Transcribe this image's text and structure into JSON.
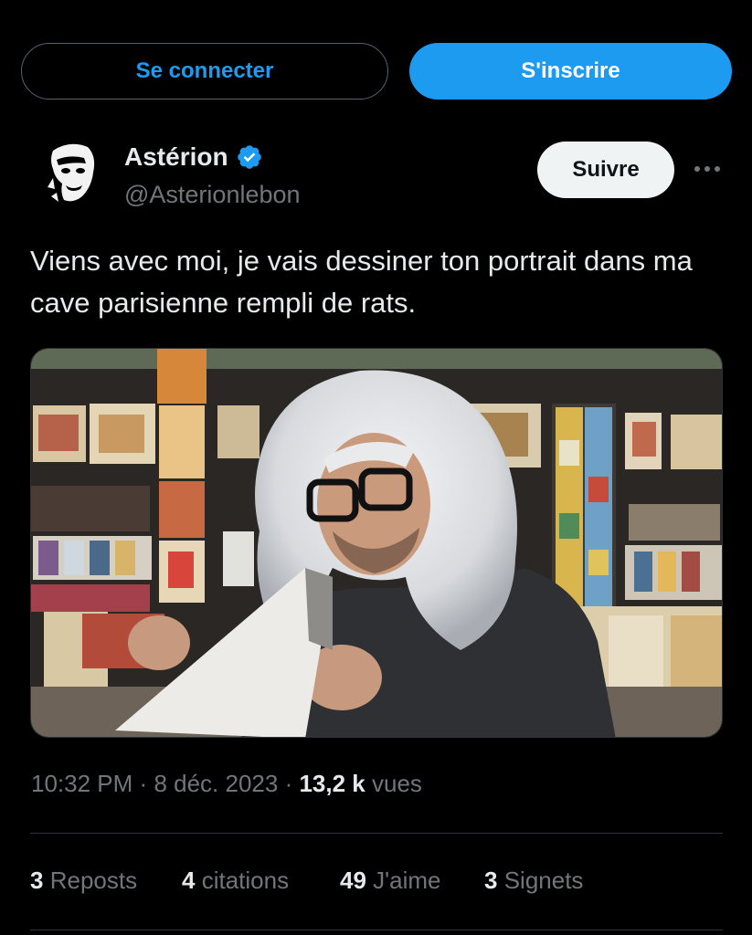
{
  "auth": {
    "login_label": "Se connecter",
    "signup_label": "S'inscrire"
  },
  "author": {
    "name": "Astérion",
    "handle": "@Asterionlebon",
    "verified": true,
    "avatar_icon": "profile-avatar"
  },
  "actions": {
    "follow_label": "Suivre",
    "more_icon": "more-horizontal-icon"
  },
  "tweet": {
    "text": "Viens avec moi, je vais dessiner ton portrait dans ma cave parisienne rempli de rats.",
    "media_description_icon": "photo"
  },
  "meta": {
    "time": "10:32 PM",
    "separator": "·",
    "date": "8 déc. 2023",
    "views_count": "13,2 k",
    "views_label": "vues"
  },
  "stats": [
    {
      "count": "3",
      "label": "Reposts"
    },
    {
      "count": "4",
      "label": "citations"
    },
    {
      "count": "49",
      "label": "J'aime"
    },
    {
      "count": "3",
      "label": "Signets"
    }
  ],
  "colors": {
    "background": "#000000",
    "accent": "#1d9bf0",
    "text_primary": "#e7e9ea",
    "text_secondary": "#71767b",
    "border": "#2f3336"
  }
}
